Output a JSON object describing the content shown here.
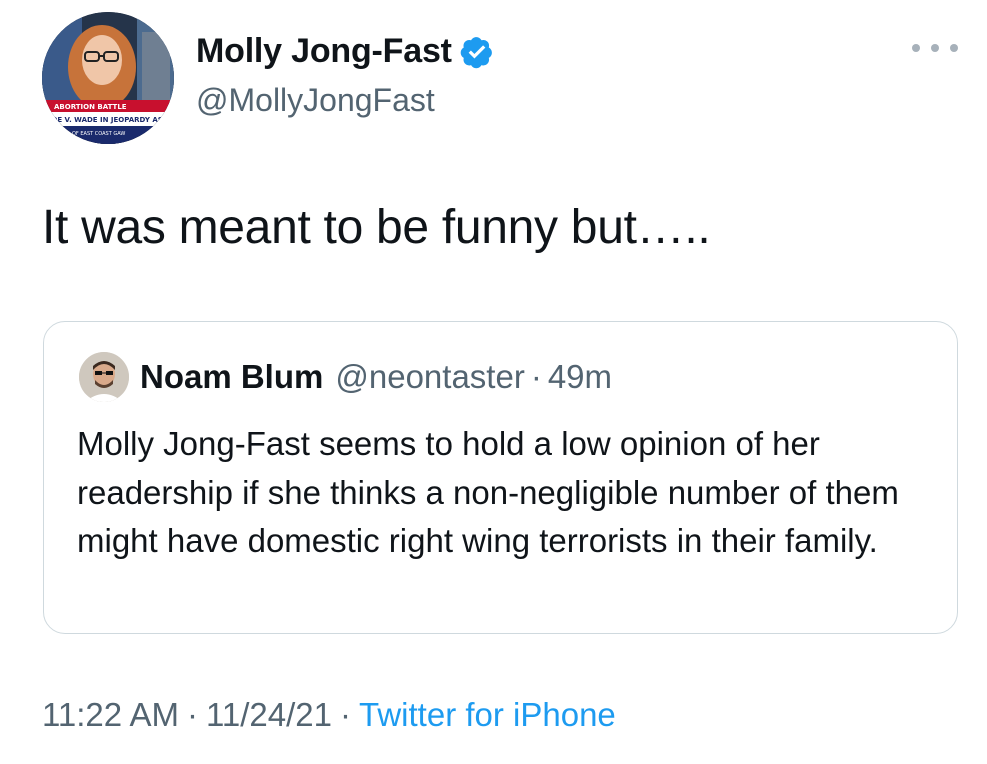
{
  "author": {
    "display_name": "Molly Jong-Fast",
    "handle": "@MollyJongFast",
    "verified": true,
    "avatar_caption_lines": [
      "ABORTION BATTLE",
      "ROE V. WADE IN JEOPARDY AS TE",
      "OF EAST COAST GAW"
    ]
  },
  "tweet": {
    "text": "It was meant to be funny but….."
  },
  "quoted_tweet": {
    "display_name": "Noam Blum",
    "handle": "@neontaster",
    "separator": "·",
    "time": "49m",
    "text": "Molly Jong-Fast seems to hold a low opinion of her readership if she thinks a non-negligible number of them might have domestic right wing terrorists in their family."
  },
  "footer": {
    "time": "11:22 AM",
    "separator1": "·",
    "date": "11/24/21",
    "separator2": "·",
    "source": "Twitter for iPhone"
  },
  "colors": {
    "text": "#0f1419",
    "secondary": "#536471",
    "link": "#1d9bf0",
    "border": "#cfd9de"
  }
}
